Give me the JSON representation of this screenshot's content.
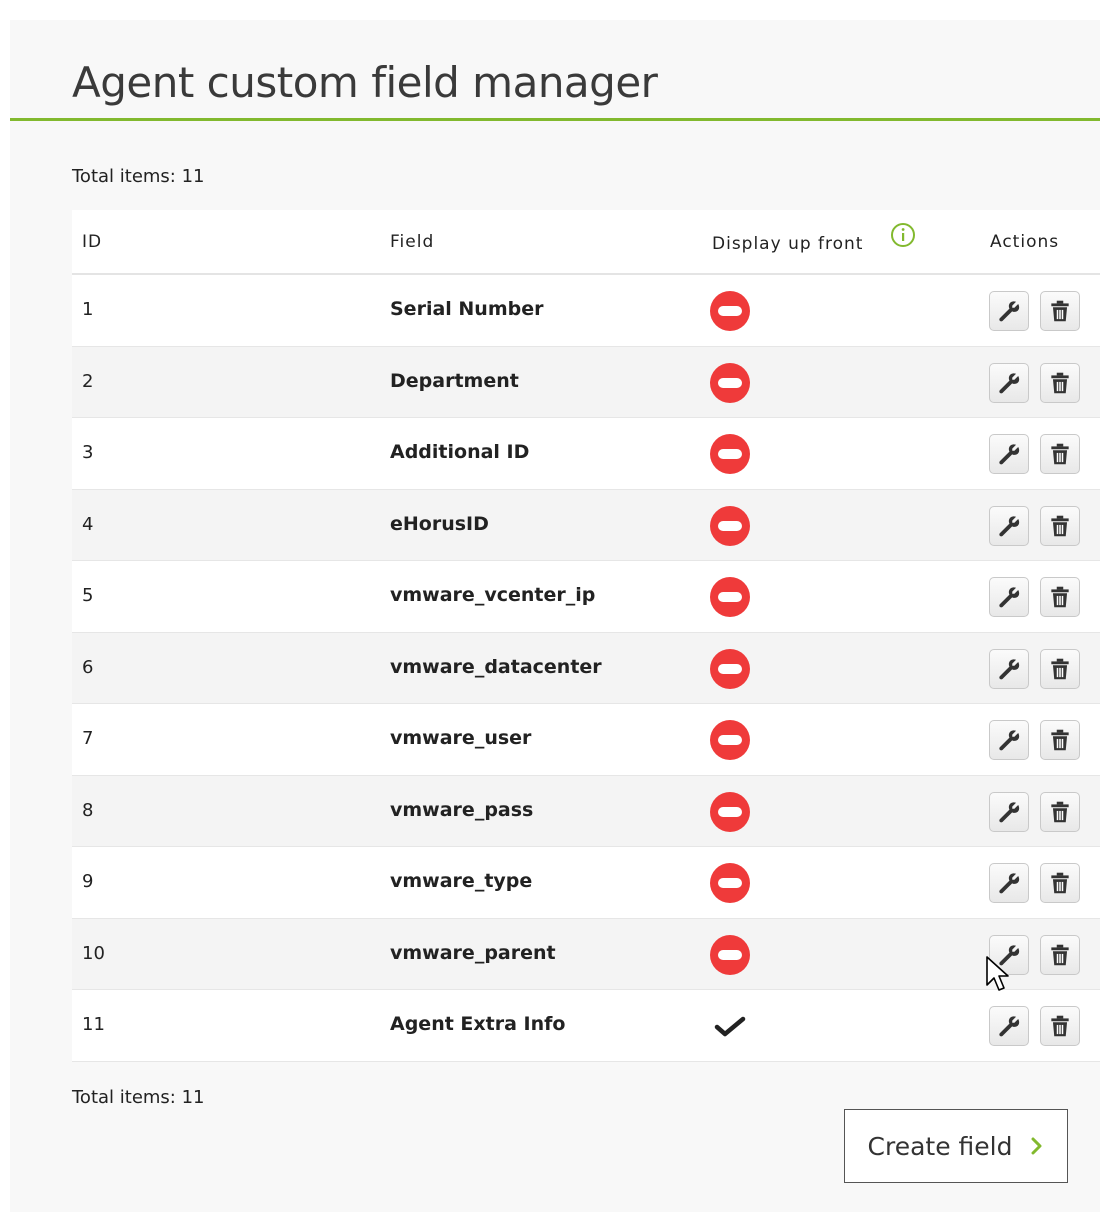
{
  "page": {
    "title": "Agent custom field manager",
    "total_top": "Total items: 11",
    "total_bottom": "Total items: 11"
  },
  "table": {
    "headers": {
      "id": "ID",
      "field": "Field",
      "display": "Display up front",
      "actions": "Actions"
    },
    "rows": [
      {
        "id": "1",
        "field": "Serial Number",
        "display_up_front": false
      },
      {
        "id": "2",
        "field": "Department",
        "display_up_front": false
      },
      {
        "id": "3",
        "field": "Additional ID",
        "display_up_front": false
      },
      {
        "id": "4",
        "field": "eHorusID",
        "display_up_front": false
      },
      {
        "id": "5",
        "field": "vmware_vcenter_ip",
        "display_up_front": false
      },
      {
        "id": "6",
        "field": "vmware_datacenter",
        "display_up_front": false
      },
      {
        "id": "7",
        "field": "vmware_user",
        "display_up_front": false
      },
      {
        "id": "8",
        "field": "vmware_pass",
        "display_up_front": false
      },
      {
        "id": "9",
        "field": "vmware_type",
        "display_up_front": false
      },
      {
        "id": "10",
        "field": "vmware_parent",
        "display_up_front": false
      },
      {
        "id": "11",
        "field": "Agent Extra Info",
        "display_up_front": true
      }
    ],
    "icons": {
      "info": "info-icon",
      "not_displayed": "no-entry-icon",
      "displayed": "checkmark-icon",
      "edit": "wrench-icon",
      "delete": "trash-icon"
    }
  },
  "create_button": {
    "label": "Create field"
  },
  "colors": {
    "accent": "#82b92e",
    "not_displayed": "#ef3a3a",
    "text": "#222222"
  }
}
